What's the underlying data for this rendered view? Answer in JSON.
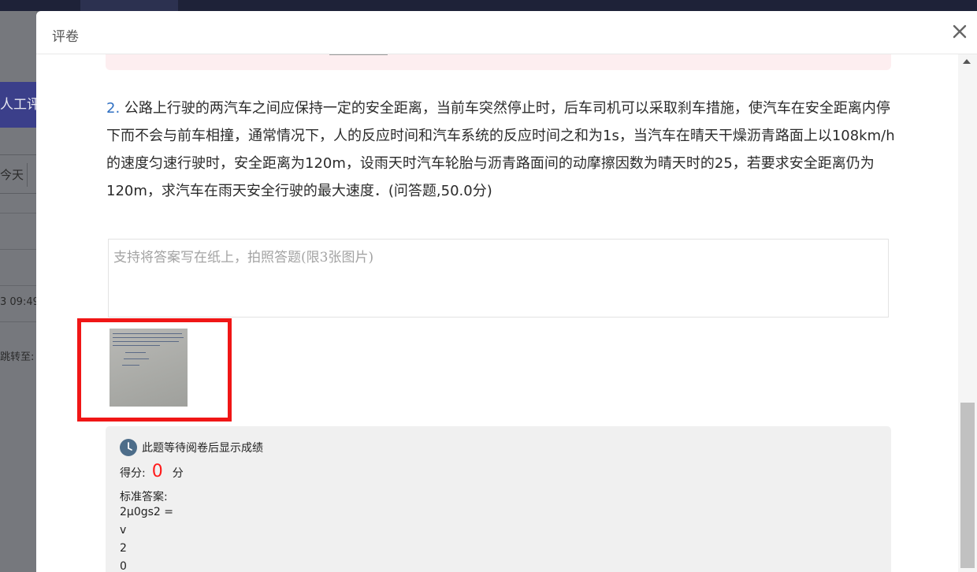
{
  "background": {
    "button_label": "人工评卷",
    "filter_today": "今天",
    "time_text": "3 09:49",
    "jump_text": "跳转至:"
  },
  "modal": {
    "title": "评卷",
    "close_icon": "close-icon"
  },
  "question": {
    "number": "2.",
    "text": "公路上行驶的两汽车之间应保持一定的安全距离，当前车突然停止时，后车司机可以采取刹车措施，使汽车在安全距离内停下而不会与前车相撞，通常情况下，人的反应时间和汽车系统的反应时间之和为1s，当汽车在晴天干燥沥青路面上以108km/h的速度匀速行驶时，安全距离为120m，设雨天时汽车轮胎与沥青路面间的动摩擦因数为晴天时的25，若要求安全距离仍为120m，求汽车在雨天安全行驶的最大速度．(问答题,50.0分)"
  },
  "answer": {
    "placeholder": "支持将答案写在纸上，拍照答题(限3张图片)"
  },
  "result": {
    "status_text": "此题等待阅卷后显示成绩",
    "score_label": "得分:",
    "score_value": "0",
    "score_unit": "分",
    "standard_answer_label": "标准答案:",
    "standard_answer_lines": [
      "2μ0gs2 =",
      "v",
      "2",
      "0"
    ]
  },
  "colors": {
    "highlight": "#f01616",
    "score": "#ff1a1a",
    "question_number": "#2f6fc2"
  }
}
